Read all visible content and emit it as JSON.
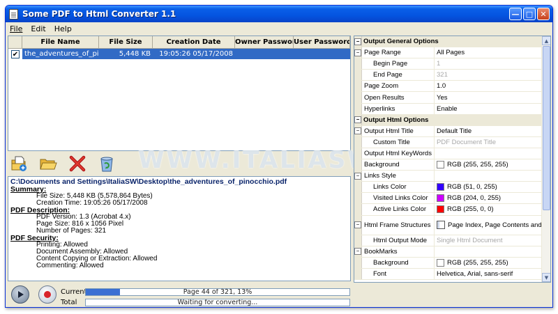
{
  "window": {
    "title": "Some PDF to Html Converter 1.1"
  },
  "menu": [
    "File",
    "Edit",
    "Help"
  ],
  "file_grid": {
    "columns": [
      "File Name",
      "File Size",
      "Creation Date",
      "Owner Password",
      "User Password"
    ],
    "rows": [
      {
        "checked": true,
        "check_mark": "✔",
        "name": "the_adventures_of_pinocc...",
        "size": "5,448 KB",
        "date": "19:05:26 05/17/2008",
        "owner_password": "",
        "user_password": ""
      }
    ]
  },
  "watermark": "WWW.ITALIASW.COM",
  "toolbar": {
    "buttons": [
      "add-file-icon",
      "open-folder-icon",
      "delete-icon",
      "recycle-bin-icon"
    ]
  },
  "info": {
    "path": "C:\\Documents and Settings\\ItaliaSW\\Desktop\\the_adventures_of_pinocchio.pdf",
    "summary_label": "Summary:",
    "summary": [
      "File Size: 5,448 KB (5,578,864 Bytes)",
      "Creation Time: 19:05:26 05/17/2008"
    ],
    "description_label": "PDF Description:",
    "description": [
      "PDF Version: 1.3 (Acrobat 4.x)",
      "Page Size: 816 x 1056 Pixel",
      "Number of Pages: 321"
    ],
    "security_label": "PDF Security:",
    "security": [
      "Printing: Allowed",
      "Document Assembly: Allowed",
      "Content Copying or Extraction: Allowed",
      "Commenting: Allowed"
    ]
  },
  "progress": {
    "current_label": "Current",
    "current_text": "Page 44 of 321, 13%",
    "current_percent": 13,
    "total_label": "Total",
    "total_text": "Waiting for converting...",
    "total_percent": 0
  },
  "properties": {
    "general_header": "Output General Options",
    "page_range": {
      "label": "Page Range",
      "value": "All Pages"
    },
    "begin_page": {
      "label": "Begin Page",
      "value": "1"
    },
    "end_page": {
      "label": "End Page",
      "value": "321"
    },
    "page_zoom": {
      "label": "Page Zoom",
      "value": "1.0"
    },
    "open_results": {
      "label": "Open Results",
      "value": "Yes"
    },
    "hyperlinks": {
      "label": "Hyperlinks",
      "value": "Enable"
    },
    "html_header": "Output Html Options",
    "html_title": {
      "label": "Output Html Title",
      "value": "Default Title"
    },
    "custom_title": {
      "label": "Custom Title",
      "value": "PDF Document Title"
    },
    "keywords": {
      "label": "Output Html KeyWords",
      "value": ""
    },
    "background": {
      "label": "Background",
      "value": "RGB (255, 255, 255)",
      "color": "#ffffff"
    },
    "links_style": {
      "label": "Links Style"
    },
    "links_color": {
      "label": "Links Color",
      "value": "RGB (51, 0, 255)",
      "color": "#3300ff"
    },
    "visited_color": {
      "label": "Visited Links Color",
      "value": "RGB (204, 0, 255)",
      "color": "#cc00ff"
    },
    "active_color": {
      "label": "Active Links Color",
      "value": "RGB (255, 0, 0)",
      "color": "#ff0000"
    },
    "frame_structures": {
      "label": "Html Frame Structures",
      "value": "Page Index, Page Contents and Na"
    },
    "output_mode": {
      "label": "Html Output Mode",
      "value": "Single Html Document"
    },
    "bookmarks": {
      "label": "BookMarks"
    },
    "bm_background": {
      "label": "Background",
      "value": "RGB (255, 255, 255)",
      "color": "#ffffff"
    },
    "font": {
      "label": "Font",
      "value": "Helvetica, Arial, sans-serif"
    }
  }
}
